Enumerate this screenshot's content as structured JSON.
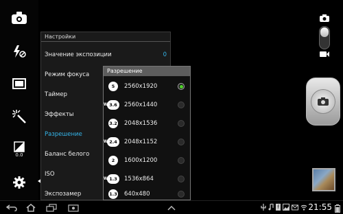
{
  "settings": {
    "title": "Настройки",
    "items": [
      {
        "label": "Значение экспозиции",
        "value": "0"
      },
      {
        "label": "Режим фокуса",
        "value": ""
      },
      {
        "label": "Таймер",
        "value": ""
      },
      {
        "label": "Эффекты",
        "value": ""
      },
      {
        "label": "Разрешение",
        "value": ""
      },
      {
        "label": "Баланс белого",
        "value": ""
      },
      {
        "label": "ISO",
        "value": ""
      },
      {
        "label": "Экспозамер",
        "value": ""
      }
    ],
    "selected_index": 4
  },
  "resolution": {
    "title": "Разрешение",
    "options": [
      {
        "badge": "5",
        "wide": false,
        "label": "2560x1920",
        "selected": true
      },
      {
        "badge": "3.6",
        "wide": true,
        "label": "2560x1440",
        "selected": false
      },
      {
        "badge": "3.2",
        "wide": false,
        "label": "2048x1536",
        "selected": false
      },
      {
        "badge": "2.4",
        "wide": true,
        "label": "2048x1152",
        "selected": false
      },
      {
        "badge": "2",
        "wide": false,
        "label": "1600x1200",
        "selected": false
      },
      {
        "badge": "1.3",
        "wide": true,
        "label": "1536x864",
        "selected": false
      },
      {
        "badge": "1.3",
        "wide": false,
        "label": "640x480",
        "selected": false
      }
    ]
  },
  "left_bar": {
    "exposure_value": "0.0",
    "icons": [
      "switch-camera-icon",
      "flash-off-icon",
      "shooting-mode-icon",
      "effects-wand-icon",
      "exposure-icon",
      "settings-gear-icon"
    ]
  },
  "status_bar": {
    "time": "21:55"
  },
  "colors": {
    "accent": "#35b6ea",
    "radio_selected": "#4fd32a"
  }
}
